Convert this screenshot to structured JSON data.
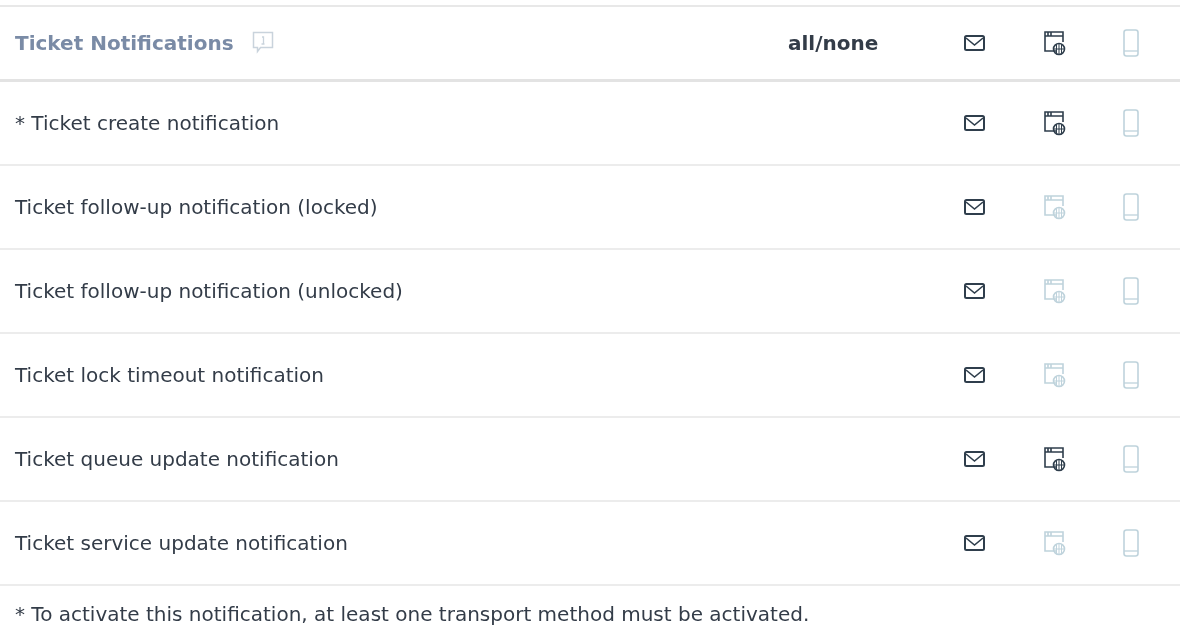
{
  "header": {
    "title": "Ticket Notifications",
    "all_none": "all/none",
    "transports": [
      {
        "kind": "email",
        "checked": true
      },
      {
        "kind": "web",
        "checked": true
      },
      {
        "kind": "mobile",
        "checked": false
      }
    ]
  },
  "rows": [
    {
      "label": "* Ticket create notification",
      "transports": [
        {
          "kind": "email",
          "checked": true
        },
        {
          "kind": "web",
          "checked": true
        },
        {
          "kind": "mobile",
          "checked": false
        }
      ]
    },
    {
      "label": "Ticket follow-up notification (locked)",
      "transports": [
        {
          "kind": "email",
          "checked": true
        },
        {
          "kind": "web",
          "checked": false
        },
        {
          "kind": "mobile",
          "checked": false
        }
      ]
    },
    {
      "label": "Ticket follow-up notification (unlocked)",
      "transports": [
        {
          "kind": "email",
          "checked": true
        },
        {
          "kind": "web",
          "checked": false
        },
        {
          "kind": "mobile",
          "checked": false
        }
      ]
    },
    {
      "label": "Ticket lock timeout notification",
      "transports": [
        {
          "kind": "email",
          "checked": true
        },
        {
          "kind": "web",
          "checked": false
        },
        {
          "kind": "mobile",
          "checked": false
        }
      ]
    },
    {
      "label": "Ticket queue update notification",
      "transports": [
        {
          "kind": "email",
          "checked": true
        },
        {
          "kind": "web",
          "checked": true
        },
        {
          "kind": "mobile",
          "checked": false
        }
      ]
    },
    {
      "label": "Ticket service update notification",
      "transports": [
        {
          "kind": "email",
          "checked": true
        },
        {
          "kind": "web",
          "checked": false
        },
        {
          "kind": "mobile",
          "checked": false
        }
      ]
    }
  ],
  "footnote": "* To activate this notification, at least one transport method must be activated."
}
